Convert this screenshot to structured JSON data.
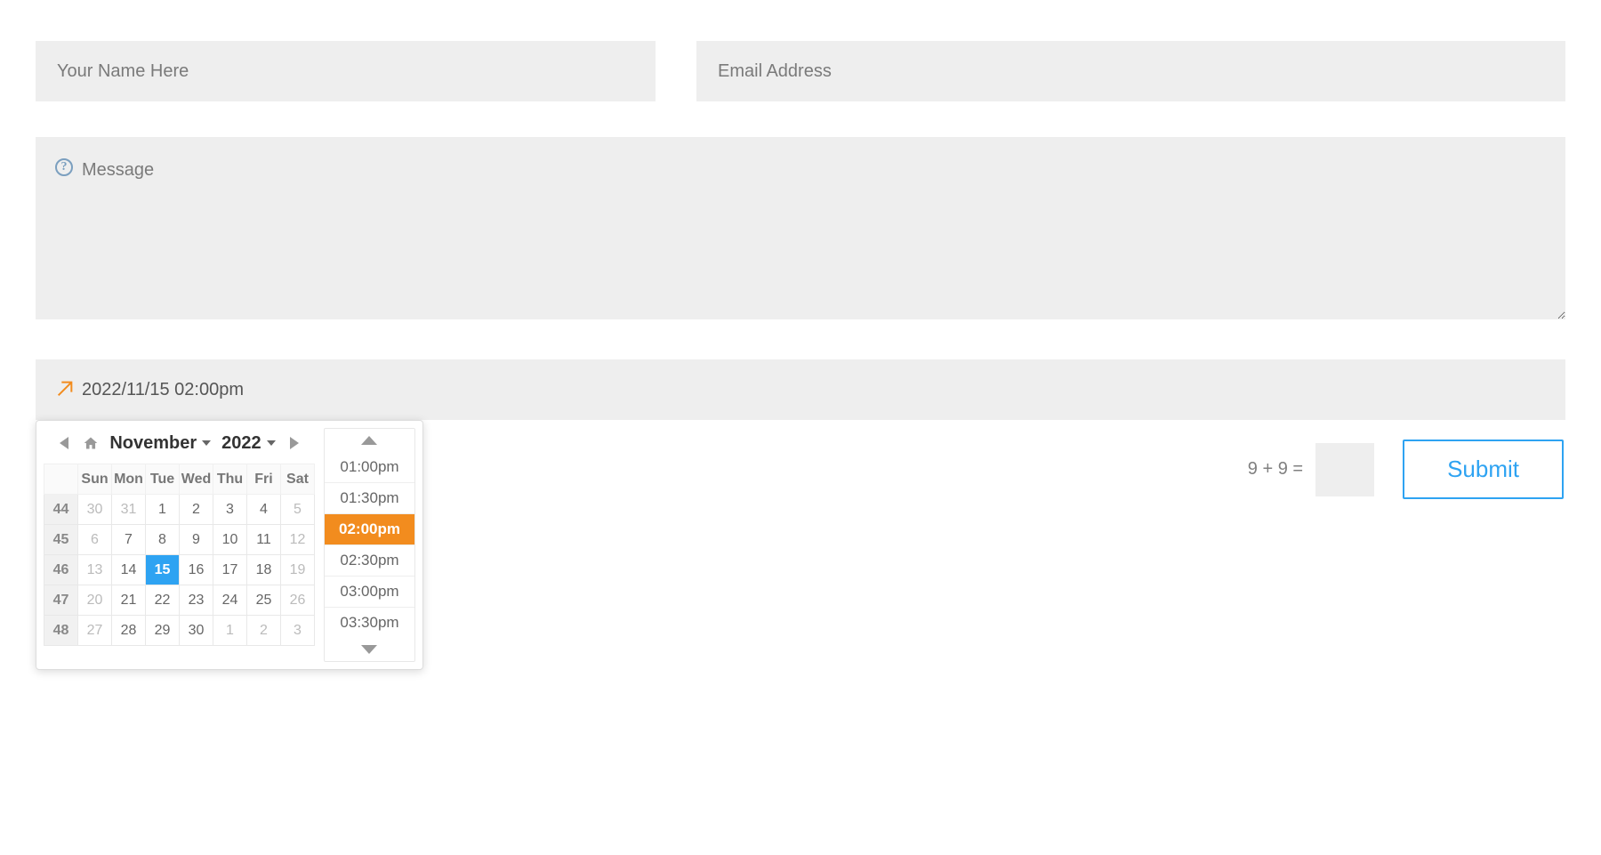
{
  "form": {
    "name_placeholder": "Your Name Here",
    "email_placeholder": "Email Address",
    "message_placeholder": "Message",
    "datetime_value": "2022/11/15 02:00pm",
    "captcha_label": "9 + 9 =",
    "submit_label": "Submit"
  },
  "picker": {
    "month_label": "November",
    "year_label": "2022",
    "dow": [
      "Sun",
      "Mon",
      "Tue",
      "Wed",
      "Thu",
      "Fri",
      "Sat"
    ],
    "weeks": [
      {
        "wk": "44",
        "days": [
          {
            "d": "30",
            "other": true
          },
          {
            "d": "31",
            "other": true
          },
          {
            "d": "1"
          },
          {
            "d": "2"
          },
          {
            "d": "3"
          },
          {
            "d": "4"
          },
          {
            "d": "5",
            "other": true
          }
        ]
      },
      {
        "wk": "45",
        "days": [
          {
            "d": "6",
            "other": true
          },
          {
            "d": "7"
          },
          {
            "d": "8"
          },
          {
            "d": "9"
          },
          {
            "d": "10"
          },
          {
            "d": "11"
          },
          {
            "d": "12",
            "other": true
          }
        ]
      },
      {
        "wk": "46",
        "days": [
          {
            "d": "13",
            "other": true
          },
          {
            "d": "14"
          },
          {
            "d": "15",
            "sel": true
          },
          {
            "d": "16"
          },
          {
            "d": "17"
          },
          {
            "d": "18"
          },
          {
            "d": "19",
            "other": true
          }
        ]
      },
      {
        "wk": "47",
        "days": [
          {
            "d": "20",
            "other": true
          },
          {
            "d": "21"
          },
          {
            "d": "22"
          },
          {
            "d": "23"
          },
          {
            "d": "24"
          },
          {
            "d": "25"
          },
          {
            "d": "26",
            "other": true
          }
        ]
      },
      {
        "wk": "48",
        "days": [
          {
            "d": "27",
            "other": true
          },
          {
            "d": "28"
          },
          {
            "d": "29"
          },
          {
            "d": "30"
          },
          {
            "d": "1",
            "other": true
          },
          {
            "d": "2",
            "other": true
          },
          {
            "d": "3",
            "other": true
          }
        ]
      }
    ],
    "times": [
      {
        "t": "01:00pm"
      },
      {
        "t": "01:30pm"
      },
      {
        "t": "02:00pm",
        "sel": true
      },
      {
        "t": "02:30pm"
      },
      {
        "t": "03:00pm"
      },
      {
        "t": "03:30pm"
      }
    ]
  }
}
